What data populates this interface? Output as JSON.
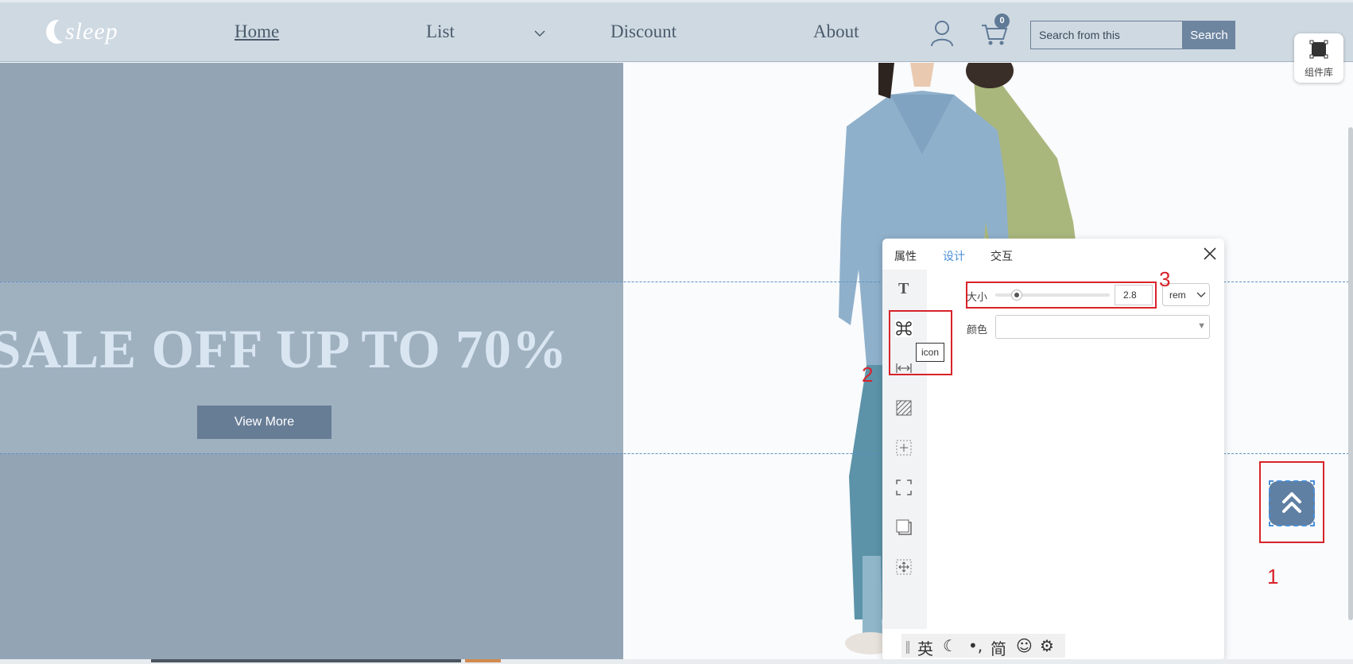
{
  "header": {
    "logo_text": "sleep",
    "nav": {
      "home": "Home",
      "list": "List",
      "discount": "Discount",
      "about": "About"
    },
    "cart_count": "0",
    "search_placeholder": "Search from this",
    "search_label": "Search"
  },
  "component_library_label": "组件库",
  "hero": {
    "title": "SALE OFF UP TO 70%",
    "button_label": "View More"
  },
  "panel": {
    "tabs": [
      "属性",
      "设计",
      "交互"
    ],
    "active_tab": "设计",
    "tooltip": "icon",
    "size_label": "大小",
    "size_value": "2.8",
    "size_slider_fraction": 0.19,
    "unit": "rem",
    "color_label": "颜色"
  },
  "ime": {
    "items": [
      "英",
      "☾",
      "•,",
      "简",
      "☺",
      "⚙"
    ]
  },
  "annotations": [
    "1",
    "2",
    "3"
  ],
  "colors": {
    "header_bg": "#cfd9e2",
    "hero_left": "#93a5b5",
    "accent": "#677d96",
    "annotation_red": "#d8232a",
    "active_tab": "#4a90d9"
  }
}
